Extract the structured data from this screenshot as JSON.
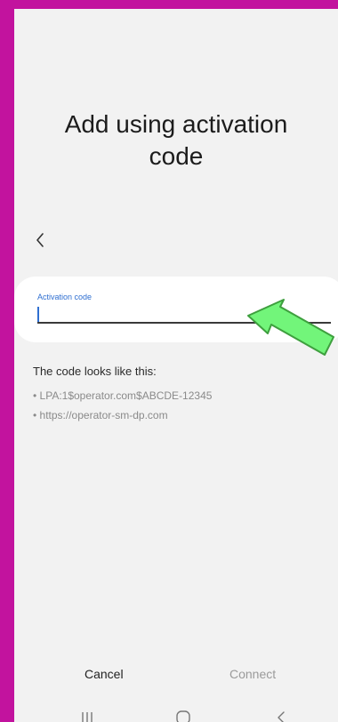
{
  "screen": {
    "title_line1": "Add using activation",
    "title_line2": "code"
  },
  "field": {
    "label": "Activation code",
    "value": ""
  },
  "hint": {
    "title": "The code looks like this:",
    "items": [
      "• LPA:1$operator.com$ABCDE-12345",
      "• https://operator-sm-dp.com"
    ]
  },
  "buttons": {
    "cancel": "Cancel",
    "connect": "Connect"
  },
  "icons": {
    "back": "chevron-left-icon",
    "recent_apps": "recent-apps-icon",
    "home": "home-icon",
    "nav_back": "nav-back-icon",
    "annotation_arrow": "arrow-icon"
  },
  "colors": {
    "frame": "#c2139e",
    "accent": "#2f6fd1",
    "annotation_arrow": "#72f57a"
  }
}
